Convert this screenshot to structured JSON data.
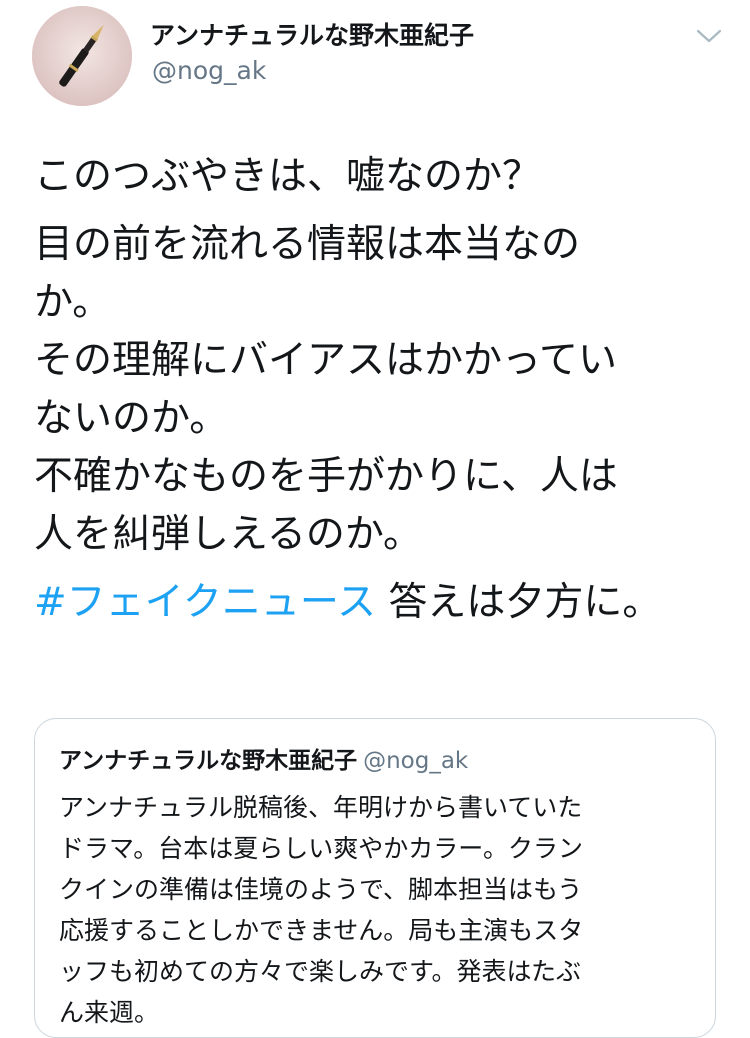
{
  "tweet": {
    "display_name": "アンナチュラルな野木亜紀子",
    "handle": "@nog_ak",
    "lines": [
      "このつぶやきは、嘘なのか？",
      "目の前を流れる情報は本当なの",
      "か。",
      "その理解にバイアスはかかってい",
      "ないのか。",
      "不確かなものを手がかりに、人は",
      "人を糾弾しえるのか。"
    ],
    "hashtag": "#フェイクニュース",
    "after_hashtag": "答えは夕方に。"
  },
  "quoted": {
    "display_name": "アンナチュラルな野木亜紀子",
    "handle": "@nog_ak",
    "lines": [
      "アンナチュラル脱稿後、年明けから書いていた",
      "ドラマ。台本は夏らしい爽やかカラー。クラン",
      "クインの準備は佳境のようで、脚本担当はもう",
      "応援することしかできません。局も主演もスタ",
      "ッフも初めての方々で楽しみです。発表はたぶ",
      "ん来週。"
    ]
  },
  "icons": {
    "avatar": "fountain-pen-avatar",
    "menu": "chevron-down-icon"
  },
  "colors": {
    "text": "#14171a",
    "secondary": "#657786",
    "link": "#1da1f2",
    "border": "#ccd6dd"
  }
}
